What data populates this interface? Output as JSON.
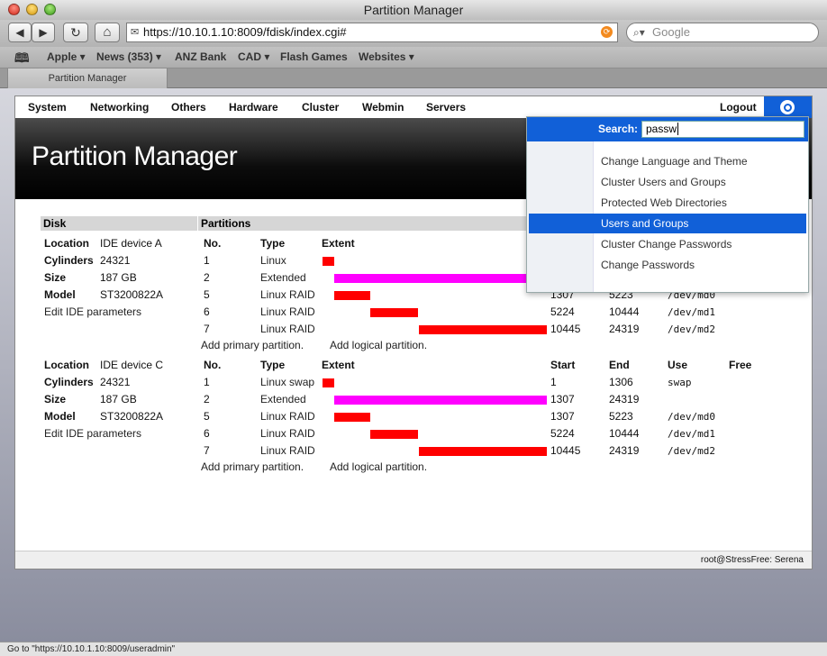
{
  "window": {
    "title": "Partition Manager"
  },
  "toolbar": {
    "back_icon": "◀",
    "forward_icon": "▶",
    "reload_icon": "↻",
    "home_icon": "⌂",
    "url": "https://10.10.1.10:8009/fdisk/index.cgi#",
    "search_placeholder": "Google"
  },
  "bookmarks": {
    "items": [
      {
        "label": "Apple ▾"
      },
      {
        "label": "News (353) ▾"
      },
      {
        "label": "ANZ Bank"
      },
      {
        "label": "CAD ▾"
      },
      {
        "label": "Flash Games"
      },
      {
        "label": "Websites ▾"
      }
    ]
  },
  "tab": {
    "label": "Partition Manager"
  },
  "menu": {
    "items": [
      "System",
      "Networking",
      "Others",
      "Hardware",
      "Cluster",
      "Webmin",
      "Servers"
    ],
    "logout": "Logout"
  },
  "banner": {
    "title": "Partition Manager"
  },
  "table": {
    "disk_header": "Disk",
    "partitions_header": "Partitions",
    "cols": {
      "no": "No.",
      "type": "Type",
      "extent": "Extent",
      "start": "Start",
      "end": "End",
      "use": "Use",
      "free": "Free"
    },
    "add_primary": "Add primary partition.",
    "add_logical": "Add logical partition.",
    "disks": [
      {
        "location_label": "Location",
        "location": "IDE device A",
        "cylinders_label": "Cylinders",
        "cylinders": "24321",
        "size_label": "Size",
        "size": "187 GB",
        "model_label": "Model",
        "model": "ST3200822A",
        "edit": "Edit IDE parameters",
        "partitions": [
          {
            "no": "1",
            "type": "Linux",
            "start": "",
            "end": "",
            "use": ""
          },
          {
            "no": "2",
            "type": "Extended",
            "start": "",
            "end": "",
            "use": ""
          },
          {
            "no": "5",
            "type": "Linux RAID",
            "start": "1307",
            "end": "5223",
            "use": "/dev/md0"
          },
          {
            "no": "6",
            "type": "Linux RAID",
            "start": "5224",
            "end": "10444",
            "use": "/dev/md1"
          },
          {
            "no": "7",
            "type": "Linux RAID",
            "start": "10445",
            "end": "24319",
            "use": "/dev/md2"
          }
        ]
      },
      {
        "location_label": "Location",
        "location": "IDE device C",
        "cylinders_label": "Cylinders",
        "cylinders": "24321",
        "size_label": "Size",
        "size": "187 GB",
        "model_label": "Model",
        "model": "ST3200822A",
        "edit": "Edit IDE parameters",
        "partitions": [
          {
            "no": "1",
            "type": "Linux swap",
            "start": "1",
            "end": "1306",
            "use": "swap"
          },
          {
            "no": "2",
            "type": "Extended",
            "start": "1307",
            "end": "24319",
            "use": ""
          },
          {
            "no": "5",
            "type": "Linux RAID",
            "start": "1307",
            "end": "5223",
            "use": "/dev/md0"
          },
          {
            "no": "6",
            "type": "Linux RAID",
            "start": "5224",
            "end": "10444",
            "use": "/dev/md1"
          },
          {
            "no": "7",
            "type": "Linux RAID",
            "start": "10445",
            "end": "24319",
            "use": "/dev/md2"
          }
        ]
      }
    ]
  },
  "colors": {
    "primary_extent": "#ff0000",
    "extended_extent": "#ff00ff",
    "accent": "#1160d8"
  },
  "search": {
    "label": "Search:",
    "value": "passw",
    "results": [
      {
        "label": "Change Language and Theme"
      },
      {
        "label": "Cluster Users and Groups"
      },
      {
        "label": "Protected Web Directories"
      },
      {
        "label": "Users and Groups"
      },
      {
        "label": "Cluster Change Passwords"
      },
      {
        "label": "Change Passwords"
      }
    ]
  },
  "footer": {
    "user": "root@StressFree: Serena"
  },
  "status": {
    "text": "Go to \"https://10.10.1.10:8009/useradmin\""
  }
}
